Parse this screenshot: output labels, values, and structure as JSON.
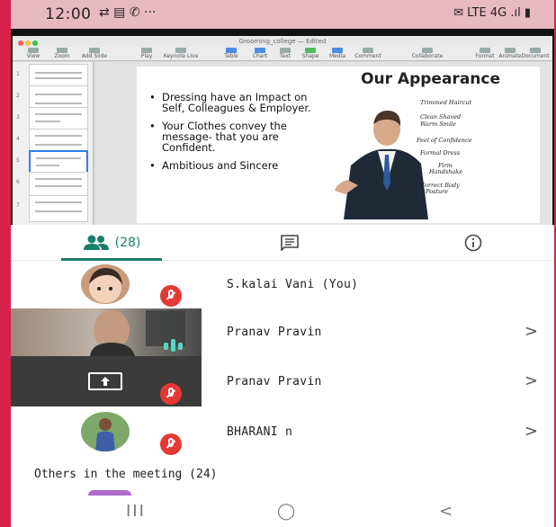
{
  "status_bar": {
    "time": "12:00",
    "left_icons": "⇄ ▤ ✆ ···",
    "right_icons": "✉ LTE 4G .ıl ▮"
  },
  "keynote": {
    "window_title": "Grooming_college — Edited",
    "toolbar": [
      "View",
      "Zoom",
      "Add Slide",
      "Play",
      "Keynote Live",
      "Table",
      "Chart",
      "Text",
      "Shape",
      "Media",
      "Comment",
      "Collaborate",
      "Format",
      "Animate",
      "Document"
    ],
    "thumb_numbers": [
      "1",
      "2",
      "3",
      "4",
      "5",
      "6",
      "7"
    ],
    "slide": {
      "title": "Our Appearance",
      "bullets": [
        "Dressing have an Impact on Self, Colleagues & Employer.",
        "Your Clothes convey the message- that you are Confident.",
        "Ambitious and Sincere"
      ],
      "annotations": [
        "Trimmed Haircut",
        "Clean Shaved",
        "Warm Smile",
        "Feel of Confidence",
        "Formal Dress",
        "Firm",
        "Handshake",
        "Correct Body",
        "Posture"
      ]
    }
  },
  "tabs": {
    "people_count": "(28)",
    "people_icon": "people-icon",
    "chat_icon": "chat-icon",
    "info_icon": "info-icon",
    "accent": "#1a7f69"
  },
  "participants": [
    {
      "name": "S.kalai Vani (You)"
    },
    {
      "name": "Pranav Pravin"
    },
    {
      "name": "Pranav Pravin"
    },
    {
      "name": "BHARANI n"
    }
  ],
  "others_label": "Others in the meeting (24)",
  "nav": {
    "recents": "III",
    "home": "◯",
    "back": "<"
  }
}
